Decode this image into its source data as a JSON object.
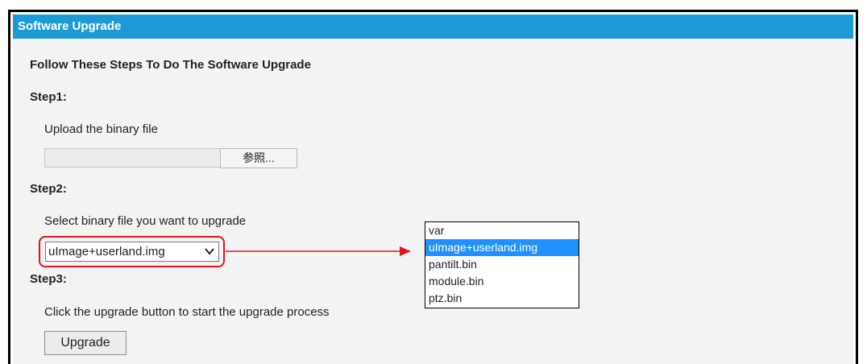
{
  "panel": {
    "title": "Software Upgrade",
    "intro": "Follow These Steps To Do The Software Upgrade"
  },
  "step1": {
    "heading": "Step1:",
    "description": "Upload the binary file",
    "file_value": "",
    "browse_label": "参照..."
  },
  "step2": {
    "heading": "Step2:",
    "description": "Select binary file you want to upgrade",
    "selected": "uImage+userland.img",
    "options": [
      "var",
      "uImage+userland.img",
      "pantilt.bin",
      "module.bin",
      "ptz.bin"
    ]
  },
  "step3": {
    "heading": "Step3:",
    "description": "Click the upgrade button to start the upgrade process",
    "upgrade_label": "Upgrade"
  },
  "colors": {
    "title_bar": "#1b9ad6",
    "highlight": "#e0141e",
    "selected_option": "#1e90ff"
  }
}
